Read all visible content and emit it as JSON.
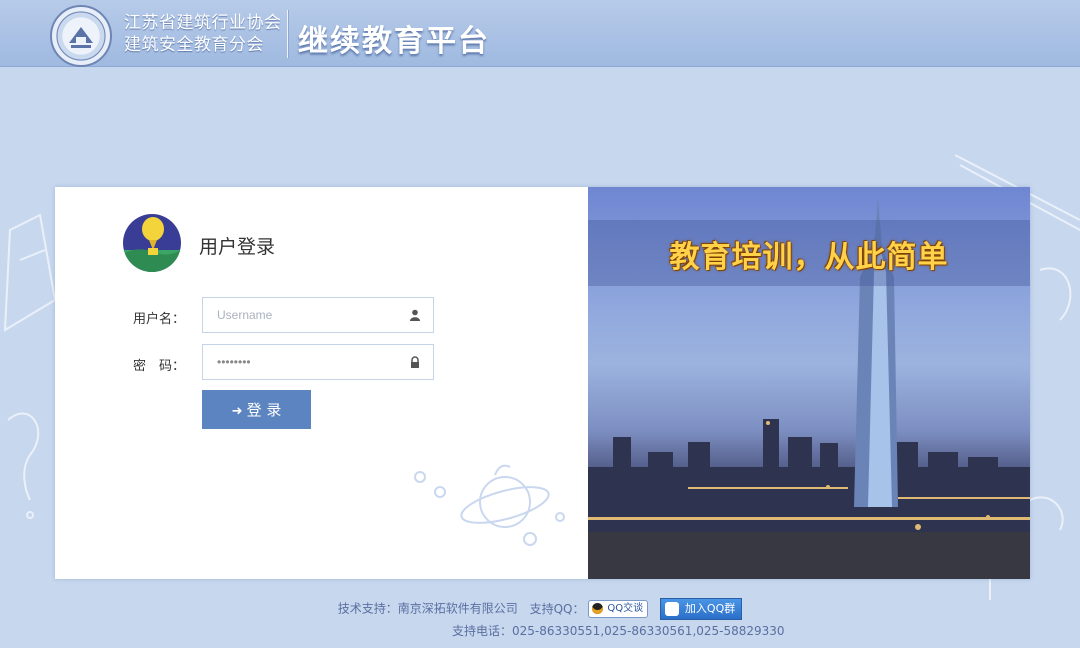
{
  "header": {
    "org_line1": "江苏省建筑行业协会",
    "org_line2": "建筑安全教育分会",
    "platform_title": "继续教育平台"
  },
  "login": {
    "title": "用户登录",
    "username_label": "用户名：",
    "username_placeholder": "Username",
    "password_label": "密　码：",
    "password_value": "********",
    "submit_label": "登 录"
  },
  "banner": {
    "slogan": "教育培训，从此简单"
  },
  "footer": {
    "tech_support": "技术支持：南京深拓软件有限公司",
    "support_qq_label": "支持QQ：",
    "qq_chat_label": "QQ交谈",
    "join_qq_group_label": "加入QQ群",
    "support_phone": "支持电话：025-86330551,025-86330561,025-58829330"
  },
  "colors": {
    "page_bg": "#c7d7ee",
    "header_bg": "#a9c1e5",
    "login_button": "#5b84c1",
    "slogan": "#ffd24a",
    "footer_text": "#5a6fa0"
  },
  "icons": {
    "username_icon": "user-icon",
    "password_icon": "lock-icon",
    "login_icon": "sign-in-icon"
  }
}
